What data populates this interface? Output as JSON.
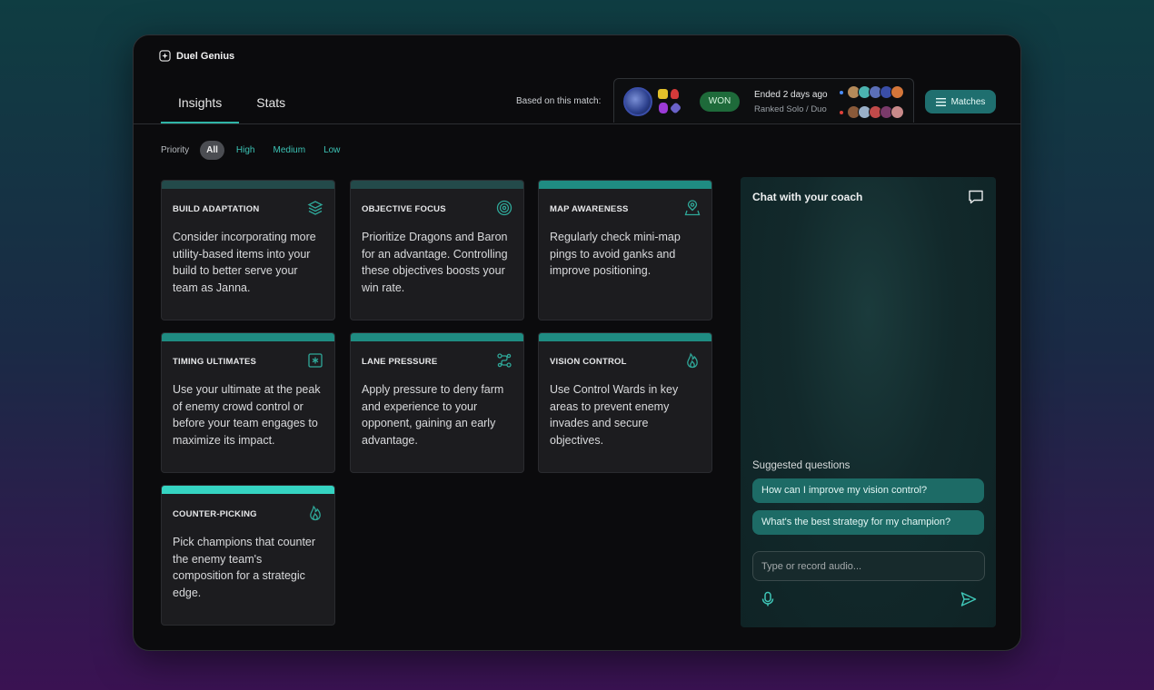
{
  "app": {
    "name": "Duel Genius"
  },
  "tabs": [
    {
      "label": "Insights"
    },
    {
      "label": "Stats"
    }
  ],
  "match": {
    "based_on_label": "Based on this match:",
    "result": "WON",
    "ended": "Ended 2 days ago",
    "queue": "Ranked Solo / Duo",
    "matches_button": "Matches"
  },
  "priority": {
    "label": "Priority",
    "options": [
      "All",
      "High",
      "Medium",
      "Low"
    ]
  },
  "colors": {
    "accent": "#2fb5a7",
    "bar_dark": "#234a4a",
    "bar_mid": "#1f8c82",
    "bar_bright": "#35d4c2"
  },
  "cards": [
    {
      "title": "BUILD ADAPTATION",
      "icon": "layers-icon",
      "body": "Consider incorporating more utility-based items into your build to better serve your team as Janna."
    },
    {
      "title": "OBJECTIVE FOCUS",
      "icon": "target-icon",
      "body": "Prioritize Dragons and Baron for an advantage. Controlling these objectives boosts your win rate."
    },
    {
      "title": "MAP AWARENESS",
      "icon": "map-pin-icon",
      "body": "Regularly check mini-map pings to avoid ganks and improve positioning."
    },
    {
      "title": "TIMING ULTIMATES",
      "icon": "asterisk-square-icon",
      "body": "Use your ultimate at the peak of enemy crowd control or before your team engages to maximize its impact."
    },
    {
      "title": "LANE PRESSURE",
      "icon": "route-icon",
      "body": "Apply pressure to deny farm and experience to your opponent, gaining an early advantage."
    },
    {
      "title": "VISION CONTROL",
      "icon": "flame-icon",
      "body": "Use Control Wards in key areas to prevent enemy invades and secure objectives."
    },
    {
      "title": "COUNTER-PICKING",
      "icon": "flame-icon",
      "body": "Pick champions that counter the enemy team's composition for a strategic edge."
    }
  ],
  "chat": {
    "title": "Chat with your coach",
    "suggested_label": "Suggested questions",
    "suggestions": [
      "How can I improve my vision control?",
      "What's the best strategy for my champion?"
    ],
    "input_placeholder": "Type or record audio..."
  }
}
